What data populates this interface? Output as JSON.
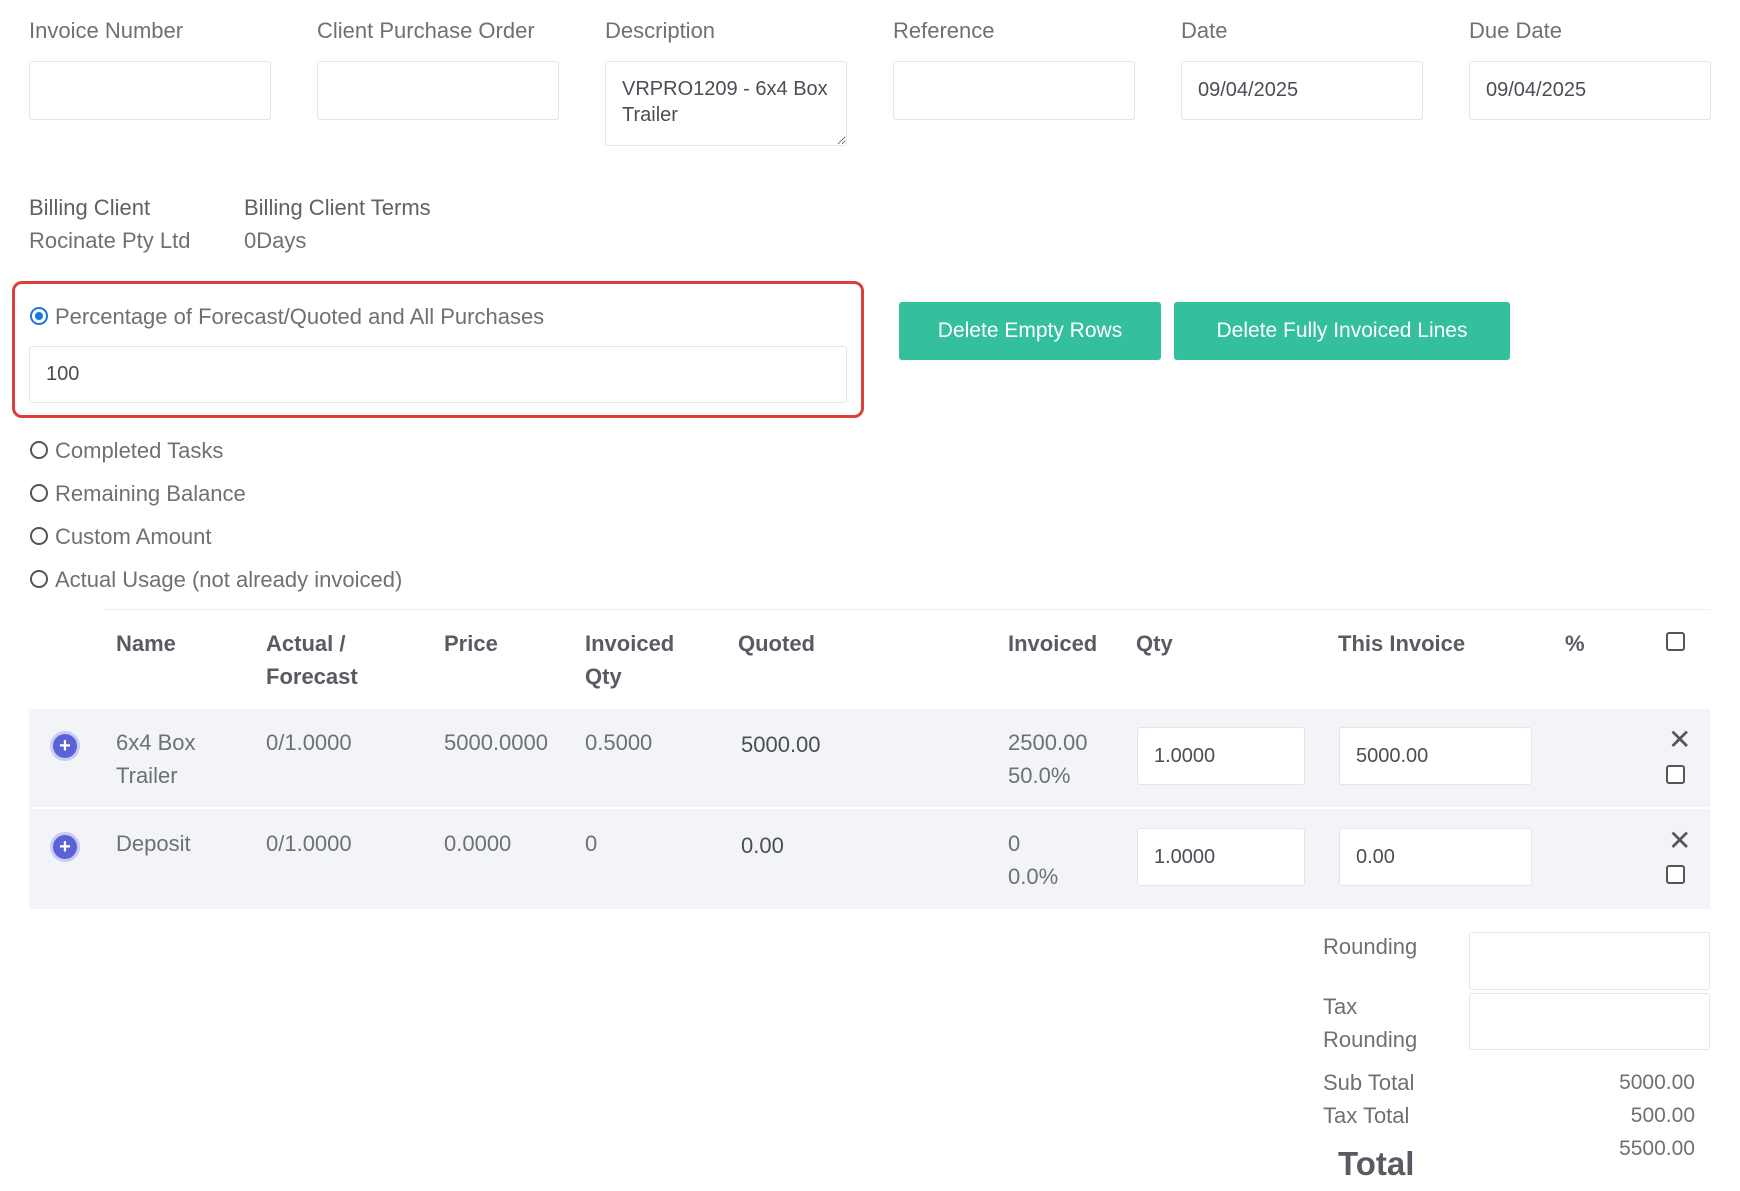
{
  "fields": {
    "invoice_number": {
      "label": "Invoice Number",
      "value": ""
    },
    "client_po": {
      "label": "Client Purchase Order",
      "value": ""
    },
    "description": {
      "label": "Description",
      "value": "VRPRO1209 - 6x4 Box Trailer"
    },
    "reference": {
      "label": "Reference",
      "value": ""
    },
    "date": {
      "label": "Date",
      "value": "09/04/2025"
    },
    "due_date": {
      "label": "Due Date",
      "value": "09/04/2025"
    }
  },
  "billing": {
    "client_label": "Billing Client",
    "client_value": "Rocinate Pty Ltd",
    "terms_label": "Billing Client Terms",
    "terms_value": "0Days"
  },
  "options": {
    "percentage_label": "Percentage of Forecast/Quoted and All Purchases",
    "percentage_value": "100",
    "completed_tasks": "Completed Tasks",
    "remaining_balance": "Remaining Balance",
    "custom_amount": "Custom Amount",
    "actual_usage": "Actual Usage (not already invoiced)",
    "selected": "percentage"
  },
  "buttons": {
    "delete_empty": "Delete Empty Rows",
    "delete_invoiced": "Delete Fully Invoiced Lines"
  },
  "table": {
    "headers": {
      "name": "Name",
      "actual_1": "Actual /",
      "actual_2": "Forecast",
      "price": "Price",
      "invqty_1": "Invoiced",
      "invqty_2": "Qty",
      "quoted": "Quoted",
      "invoiced": "Invoiced",
      "qty": "Qty",
      "this_invoice": "This Invoice",
      "pct": "%"
    },
    "rows": [
      {
        "name_1": "6x4 Box",
        "name_2": "Trailer",
        "actual": "0/1.0000",
        "price": "5000.0000",
        "invoiced_qty": "0.5000",
        "quoted": "5000.00",
        "invoiced_amt": "2500.00",
        "invoiced_pct": "50.0%",
        "qty": "1.0000",
        "this_invoice": "5000.00"
      },
      {
        "name_1": "Deposit",
        "name_2": "",
        "actual": "0/1.0000",
        "price": "0.0000",
        "invoiced_qty": "0",
        "quoted": "0.00",
        "invoiced_amt": "0",
        "invoiced_pct": "0.0%",
        "qty": "1.0000",
        "this_invoice": "0.00"
      }
    ]
  },
  "totals": {
    "rounding_label": "Rounding",
    "rounding_value": "",
    "tax_rounding_1": "Tax",
    "tax_rounding_2": "Rounding",
    "tax_rounding_value": "",
    "sub_total_label": "Sub Total",
    "sub_total_value": "5000.00",
    "tax_total_label": "Tax Total",
    "tax_total_value": "500.00",
    "total_value": "5500.00",
    "total_label": "Total"
  },
  "colors": {
    "accent_button": "#34bf9d",
    "highlight_border": "#d9413a",
    "row_bg": "#f3f4f8"
  }
}
